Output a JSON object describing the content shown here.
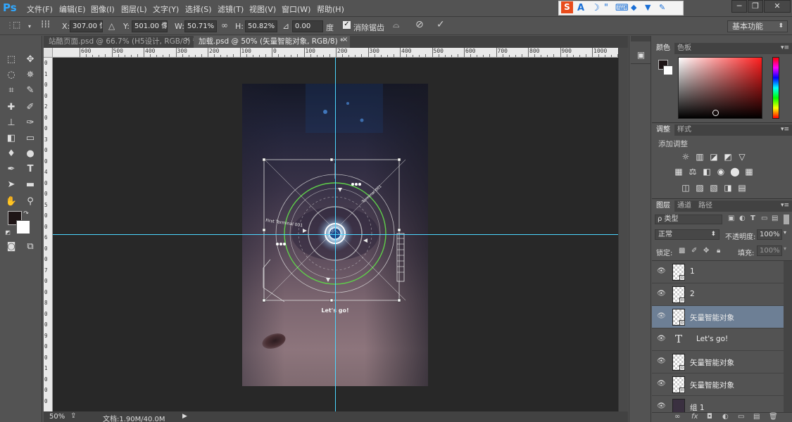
{
  "app": {
    "logo": "Ps"
  },
  "menu": [
    "文件(F)",
    "编辑(E)",
    "图像(I)",
    "图层(L)",
    "文字(Y)",
    "选择(S)",
    "滤镜(T)",
    "视图(V)",
    "窗口(W)",
    "帮助(H)"
  ],
  "ime_toolbar": {
    "items": [
      "S",
      "A",
      "☽",
      "\"",
      "⌨",
      "👕",
      "👕",
      "🔧"
    ]
  },
  "window_controls": {
    "minimize": "─",
    "restore": "❐",
    "close": "✕"
  },
  "options_bar": {
    "x_label": "X:",
    "x_value": "307.00 像素",
    "y_label": "Y:",
    "y_value": "501.00 像素",
    "w_label": "W:",
    "w_value": "50.71%",
    "link_icon": "∞",
    "h_label": "H:",
    "h_value": "50.82%",
    "angle_icon": "⊿",
    "angle_value": "0.00",
    "angle_unit": "度",
    "antialias_label": "消除锯齿",
    "workspace": "基本功能"
  },
  "tabs": [
    {
      "label": "站酷页面.psd @ 66.7% (H5设计, RGB/8) *",
      "close": "×"
    },
    {
      "label": "加载.psd @ 50% (矢量智能对象, RGB/8) *",
      "close": "×"
    }
  ],
  "ruler_top": [
    "600",
    "500",
    "400",
    "300",
    "200",
    "100",
    "0",
    "100",
    "200",
    "300",
    "400",
    "500",
    "600",
    "700",
    "800",
    "900",
    "1000",
    "1100",
    "1200"
  ],
  "ruler_left": [
    "0",
    "1",
    "0",
    "0",
    "2",
    "0",
    "0",
    "3",
    "0",
    "0",
    "4",
    "0",
    "0",
    "5",
    "0",
    "0",
    "6",
    "0",
    "0",
    "7",
    "0",
    "0",
    "8",
    "0",
    "0",
    "9",
    "0",
    "0",
    "1",
    "0",
    "0",
    "0"
  ],
  "canvas": {
    "cta": "Let's go!",
    "hud_texts": [
      "First Terminal 001",
      "Terminal 001"
    ]
  },
  "status": {
    "zoom": "50%",
    "doc_info": "文档:1.90M/40.0M"
  },
  "panels": {
    "color": {
      "tabs": [
        "颜色",
        "色板"
      ],
      "menu": "▾≡"
    },
    "adjustments": {
      "tabs": [
        "调整",
        "样式"
      ],
      "title": "添加调整",
      "menu": "▾≡"
    },
    "layers": {
      "tabs": [
        "图层",
        "通道",
        "路径"
      ],
      "filter_label": "ρ 类型",
      "blend_mode": "正常",
      "opacity_label": "不透明度:",
      "opacity_value": "100%",
      "lock_label": "锁定:",
      "fill_label": "填充:",
      "fill_value": "100%",
      "items": [
        {
          "name": "1",
          "kind": "smart"
        },
        {
          "name": "2",
          "kind": "smart"
        },
        {
          "name": "矢量智能对象",
          "kind": "smart",
          "selected": true
        },
        {
          "name": "Let's go!",
          "kind": "text"
        },
        {
          "name": "矢量智能对象",
          "kind": "smart"
        },
        {
          "name": "矢量智能对象",
          "kind": "smart"
        },
        {
          "name": "组 1",
          "kind": "group"
        }
      ]
    }
  },
  "colors": {
    "guide": "#4cd7ff",
    "selected_layer": "#6d7f95",
    "hud_green": "#5fcf4a"
  }
}
